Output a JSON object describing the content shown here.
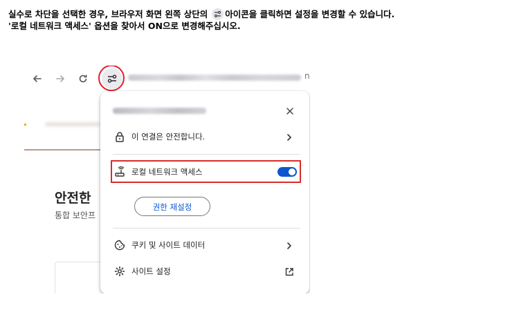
{
  "instruction": {
    "line1_before": "실수로 차단을 선택한 경우, 브라우저 화면 왼쪽 상단의",
    "line1_after": "아이콘을 클릭하면 설정을 변경할 수 있습니다.",
    "line2": "'로컬 네트워크 액세스' 옵션을 찾아서 ON으로 변경해주십시오."
  },
  "browser": {
    "url_tail": "n"
  },
  "background_page": {
    "title": "안전한 ",
    "subtitle": "통합 보안프"
  },
  "popup": {
    "close_symbol": "✕",
    "connection_label": "이 연결은 안전합니다.",
    "local_network_label": "로컬 네트워크 액세스",
    "local_network_enabled": true,
    "reset_permissions_label": "권한 재설정",
    "cookies_label": "쿠키 및 사이트 데이터",
    "site_settings_label": "사이트 설정"
  },
  "colors": {
    "highlight": "#e0202e",
    "toggle_on": "#0b57d0",
    "accent_text": "#0b57d0"
  },
  "icons": [
    "back-arrow-icon",
    "forward-arrow-icon",
    "reload-icon",
    "site-settings-icon",
    "close-icon",
    "lock-icon",
    "chevron-right-icon",
    "local-network-icon",
    "cookie-icon",
    "gear-icon",
    "external-link-icon"
  ]
}
